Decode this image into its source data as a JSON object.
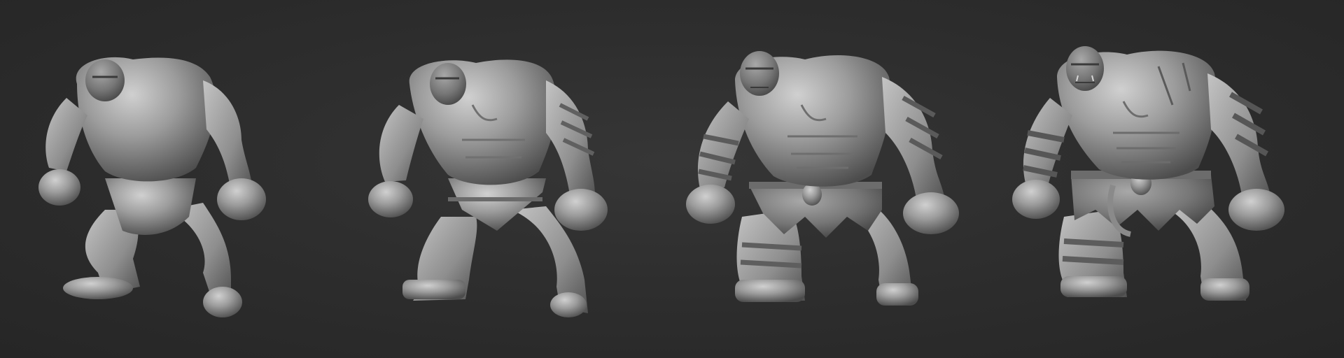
{
  "scene": {
    "background": "#2e2e2e",
    "clay_color": "#9a9a9a",
    "clay_highlight": "#c8c8c8",
    "clay_shadow": "#4a4a4a"
  },
  "figures": [
    {
      "stage": "blockout",
      "detail_level": 0.25
    },
    {
      "stage": "primary-forms",
      "detail_level": 0.5
    },
    {
      "stage": "secondary-details",
      "detail_level": 0.75
    },
    {
      "stage": "final-details",
      "detail_level": 1.0
    }
  ]
}
